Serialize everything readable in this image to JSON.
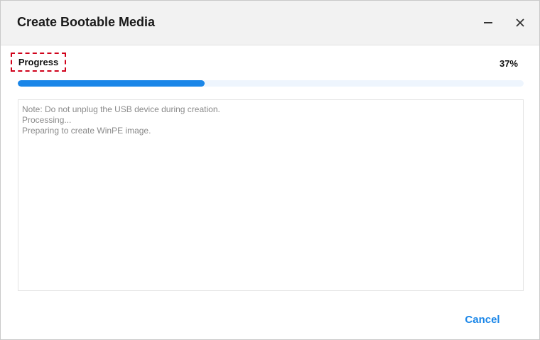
{
  "window": {
    "title": "Create Bootable Media",
    "minimize_icon": "minimize-icon",
    "close_icon": "close-icon"
  },
  "progress": {
    "label": "Progress",
    "percent_text": "37%",
    "value_percent": 37
  },
  "log": {
    "lines": [
      "Note: Do not unplug the USB device during creation.",
      "Processing...",
      "Preparing to create WinPE image."
    ]
  },
  "footer": {
    "cancel_label": "Cancel"
  },
  "colors": {
    "accent": "#1a86e8",
    "progress_track": "#eef5fd",
    "highlight_border": "#d0021b"
  }
}
